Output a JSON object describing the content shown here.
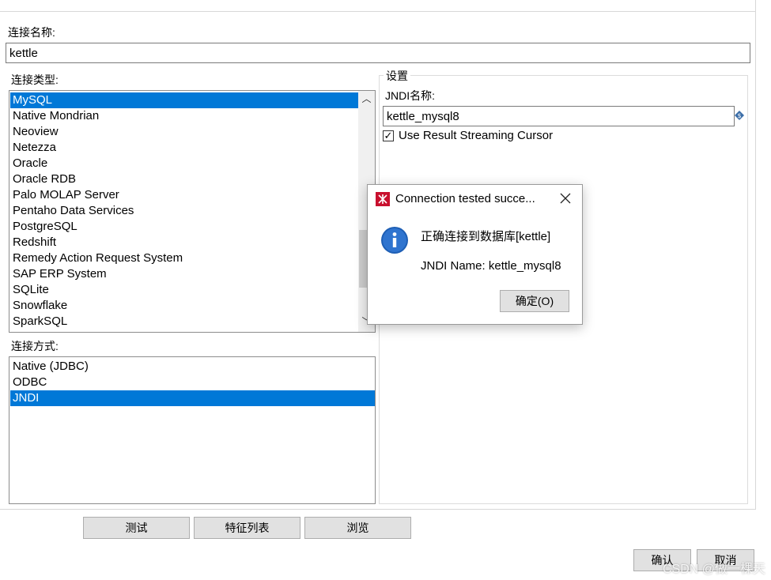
{
  "colors": {
    "selection": "#0078d7",
    "button": "#e1e1e1",
    "dialog_icon": "#1e5fb5"
  },
  "connection_name": {
    "label": "连接名称:",
    "value": "kettle"
  },
  "connection_type": {
    "label": "连接类型:",
    "items": [
      "MySQL",
      "Native Mondrian",
      "Neoview",
      "Netezza",
      "Oracle",
      "Oracle RDB",
      "Palo MOLAP Server",
      "Pentaho Data Services",
      "PostgreSQL",
      "Redshift",
      "Remedy Action Request System",
      "SAP ERP System",
      "SQLite",
      "Snowflake",
      "SparkSQL"
    ],
    "selected": "MySQL"
  },
  "access": {
    "label": "连接方式:",
    "items": [
      "Native (JDBC)",
      "ODBC",
      "JNDI"
    ],
    "selected": "JNDI"
  },
  "settings": {
    "title": "设置",
    "jndi_label": "JNDI名称:",
    "jndi_value": "kettle_mysql8",
    "streaming_label": "Use Result Streaming Cursor",
    "streaming_checked": true
  },
  "buttons": {
    "test": "测试",
    "features": "特征列表",
    "browse": "浏览",
    "ok": "确认",
    "cancel": "取消"
  },
  "dialog": {
    "title": "Connection tested succe...",
    "message": "正确连接到数据库[kettle]",
    "detail": "JNDI Name: kettle_mysql8",
    "ok": "确定(O)"
  },
  "watermark": "CSDN @做一棵天"
}
